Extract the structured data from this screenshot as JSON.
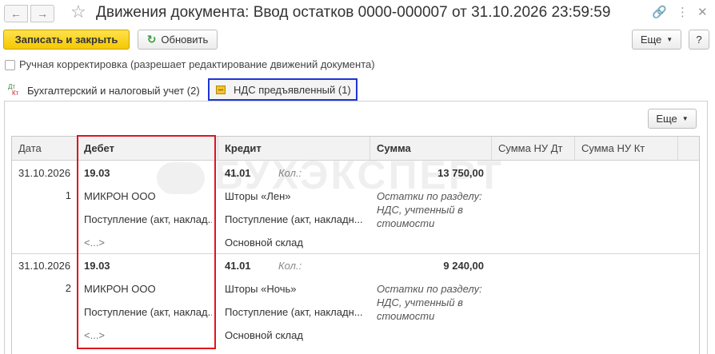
{
  "window": {
    "title": "Движения документа: Ввод остатков 0000-000007 от 31.10.2026 23:59:59"
  },
  "toolbar": {
    "write_close_label": "Записать и закрыть",
    "refresh_label": "Обновить",
    "more_label": "Еще",
    "help_label": "?"
  },
  "manual_edit": {
    "label": "Ручная корректировка (разрешает редактирование движений документа)",
    "checked": false
  },
  "tabs": [
    {
      "label": "Бухгалтерский и налоговый учет (2)",
      "icon": "dt-kt-icon"
    },
    {
      "label": "НДС предъявленный (1)",
      "icon": "vat-register-icon"
    }
  ],
  "table": {
    "more_label": "Еще",
    "columns": [
      "Дата",
      "Дебет",
      "Кредит",
      "Сумма",
      "Сумма НУ Дт",
      "Сумма НУ Кт"
    ],
    "rows": [
      {
        "date": "31.10.2026",
        "num": "1",
        "debit_account": "19.03",
        "debit_subconto1": "МИКРОН ООО",
        "debit_subconto2": "Поступление (акт, наклад...",
        "debit_subconto3": "<...>",
        "credit_account": "41.01",
        "qty_label": "Кол.:",
        "credit_subconto1": "Шторы «Лен»",
        "credit_subconto2": "Поступление (акт, накладн...",
        "credit_subconto3": "Основной склад",
        "amount": "13 750,00",
        "content_line1": "Остатки по разделу:",
        "content_line2": "НДС, учтенный в",
        "content_line3": "стоимости"
      },
      {
        "date": "31.10.2026",
        "num": "2",
        "debit_account": "19.03",
        "debit_subconto1": "МИКРОН ООО",
        "debit_subconto2": "Поступление (акт, наклад...",
        "debit_subconto3": "<...>",
        "credit_account": "41.01",
        "qty_label": "Кол.:",
        "credit_subconto1": "Шторы «Ночь»",
        "credit_subconto2": "Поступление (акт, накладн...",
        "credit_subconto3": "Основной склад",
        "amount": "9 240,00",
        "content_line1": "Остатки по разделу:",
        "content_line2": "НДС, учтенный в",
        "content_line3": "стоимости"
      }
    ]
  },
  "watermark": "БУХЭКСПЕРТ",
  "colors": {
    "primary_button": "#f5c800",
    "highlight_red": "#e0141c",
    "highlight_blue": "#1d35d6"
  }
}
